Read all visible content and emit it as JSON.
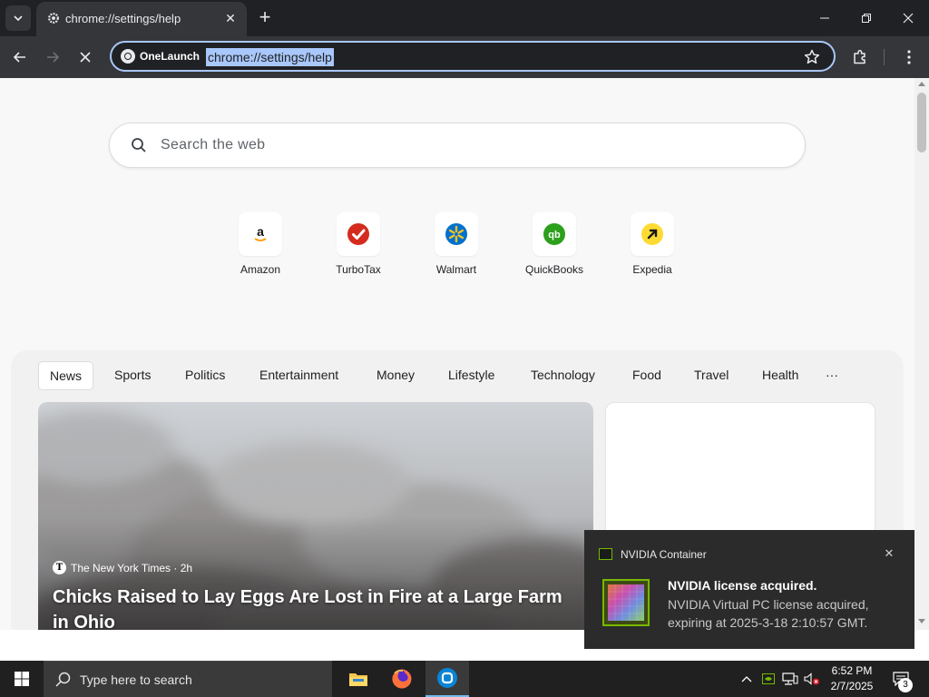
{
  "browser": {
    "tab": {
      "title": "chrome://settings/help"
    },
    "omnibox": {
      "chip_label": "OneLaunch",
      "url": "chrome://settings/help"
    }
  },
  "page": {
    "search_placeholder": "Search the web",
    "shortcuts": [
      {
        "label": "Amazon",
        "icon": "amazon-icon",
        "color": "#ff9900"
      },
      {
        "label": "TurboTax",
        "icon": "turbotax-icon",
        "color": "#d52b1e"
      },
      {
        "label": "Walmart",
        "icon": "walmart-icon",
        "color": "#0071ce"
      },
      {
        "label": "QuickBooks",
        "icon": "quickbooks-icon",
        "color": "#2ca01c"
      },
      {
        "label": "Expedia",
        "icon": "expedia-icon",
        "color": "#fddb32"
      }
    ],
    "news_categories": [
      "News",
      "Sports",
      "Politics",
      "Entertainment",
      "Money",
      "Lifestyle",
      "Technology",
      "Food",
      "Travel",
      "Health",
      "···"
    ],
    "active_category": "News",
    "hero": {
      "source_icon": "T",
      "source": "The New York Times · 2h",
      "title": "Chicks Raised to Lay Eggs Are Lost in Fire at a Large Farm in Ohio"
    }
  },
  "notification": {
    "app": "NVIDIA Container",
    "title": "NVIDIA license acquired.",
    "body": "NVIDIA Virtual PC license acquired, expiring at 2025-3-18 2:10:57 GMT.",
    "accent": "#76b900"
  },
  "taskbar": {
    "search_placeholder": "Type here to search",
    "clock": {
      "time": "6:52 PM",
      "date": "2/7/2025"
    },
    "notification_count": "3"
  }
}
